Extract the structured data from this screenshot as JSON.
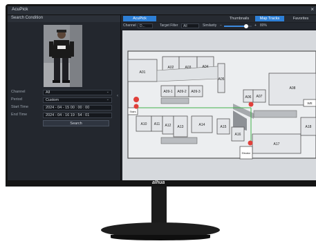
{
  "app": {
    "title": "AcuPick"
  },
  "search_panel": {
    "title": "Search Condition",
    "channel": {
      "label": "Channel",
      "value": "All"
    },
    "period": {
      "label": "Period",
      "value": "Custom"
    },
    "start_time": {
      "label": "Start Time",
      "value": "2024 - 04 - 15    00 : 00 : 00"
    },
    "end_time": {
      "label": "End Time",
      "value": "2024 - 04 - 16    19 : 54 : 01"
    },
    "search_button": "Search"
  },
  "top_tabs": {
    "acupick": "AcuPick"
  },
  "view_modes": {
    "thumbnails": "Thumbnails",
    "map_tracks": "Map Tracks",
    "favorites": "Favorites"
  },
  "filter_bar": {
    "channel_label": "Channel",
    "channel_value": "D...",
    "target_filter_label": "Target Filter",
    "target_filter_value": "All",
    "similarity_label": "Similarity",
    "similarity_value": "80%",
    "similarity_fraction": 0.8
  },
  "map": {
    "store_labels": [
      "A01",
      "A02",
      "A03",
      "A04",
      "A05",
      "A06",
      "A07",
      "A08",
      "A09-1",
      "A09-2",
      "A09-3",
      "A10",
      "A11",
      "A12",
      "A13",
      "A14",
      "A15",
      "A16",
      "A17",
      "A18"
    ],
    "other_labels": {
      "we": "WE",
      "stairs": "Stairs",
      "elevator": "Elevator"
    }
  },
  "brand": "alhua",
  "colors": {
    "accent": "#2d7fd6",
    "track_line": "#3fb24a",
    "marker": "#e0403a"
  }
}
